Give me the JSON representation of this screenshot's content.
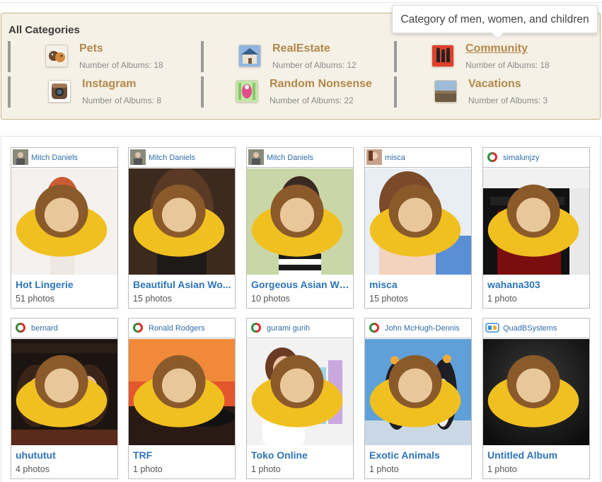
{
  "categories": {
    "title": "All Categories",
    "tooltip": "Category of men, women, and children",
    "items": [
      {
        "name": "Pets",
        "count": "Number of Albums: 18",
        "icon": "pets-icon"
      },
      {
        "name": "RealEstate",
        "count": "Number of Albums: 12",
        "icon": "realestate-icon"
      },
      {
        "name": "Community",
        "count": "Number of Albums: 18",
        "icon": "community-icon"
      },
      {
        "name": "Instagram",
        "count": "Number of Albums: 8",
        "icon": "instagram-icon"
      },
      {
        "name": "Random Nonsense",
        "count": "Number of Albums: 22",
        "icon": "random-nonsense-icon"
      },
      {
        "name": "Vacations",
        "count": "Number of Albums: 3",
        "icon": "vacations-icon"
      }
    ]
  },
  "albums": [
    {
      "owner": "Mitch Daniels",
      "title": "Hot Lingerie",
      "count": "51 photos"
    },
    {
      "owner": "Mitch Daniels",
      "title": "Beautiful Asian Wo...",
      "count": "15 photos"
    },
    {
      "owner": "Mitch Daniels",
      "title": "Gorgeous Asian Wo...",
      "count": "10 photos"
    },
    {
      "owner": "misca",
      "title": "misca",
      "count": "15 photos"
    },
    {
      "owner": "simalunjzy",
      "title": "wahana303",
      "count": "1 photo"
    },
    {
      "owner": "bernard",
      "title": "uhututut",
      "count": "4 photos"
    },
    {
      "owner": "Ronald Rodgers",
      "title": "TRF",
      "count": "1 photo"
    },
    {
      "owner": "gurami gurih",
      "title": "Toko Online",
      "count": "1 photo"
    },
    {
      "owner": "John McHugh-Dennis",
      "title": "Exotic Animals",
      "count": "1 photo"
    },
    {
      "owner": "QuadBSystems",
      "title": "Untitled Album",
      "count": "1 photo"
    }
  ],
  "colors": {
    "category_name": "#b3874a",
    "album_title": "#2e74b8",
    "owner_link": "#2e6da8",
    "panel_bg": "#f6f1e6"
  }
}
